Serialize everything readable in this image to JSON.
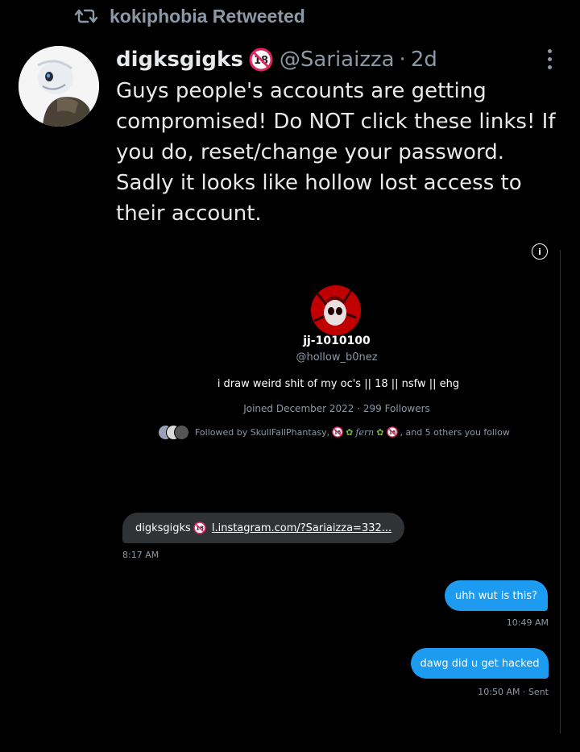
{
  "retweet": {
    "label": "kokiphobia Retweeted",
    "icon": "retweet-icon"
  },
  "tweet": {
    "author_name": "digksgigks",
    "author_handle": "@Sariaizza",
    "separator": "·",
    "time": "2d",
    "badge_text": "18",
    "text": "Guys people's accounts are getting compromised! Do NOT click these links! If you do, reset/change your password. Sadly it looks like hollow lost access to their account."
  },
  "media": {
    "info_glyph": "i",
    "profile": {
      "name": "jj-1010100",
      "handle": "@hollow_b0nez",
      "bio": "i draw weird shit of my oc's || 18 || nsfw ||   ehg",
      "joined": "Joined December 2022 · 299 Followers",
      "followed_by_prefix": "Followed by SkullFallPhantasy,",
      "followed_by_name2": "fern",
      "followed_by_suffix": ", and 5 others you follow",
      "mini_badge_text": "18"
    },
    "messages": [
      {
        "sender": "digksgigks",
        "badge": "18",
        "link": "l.instagram.com/?Sariaizza=332...",
        "time": "8:17 AM"
      },
      {
        "text": "uhh wut is this?",
        "time": "10:49 AM"
      },
      {
        "text": "dawg did u get hacked",
        "time": "10:50 AM · Sent"
      }
    ]
  },
  "colors": {
    "accent": "#1d9bf0",
    "muted": "#8b98a5",
    "background": "#000000",
    "badge_red": "#e0245e"
  }
}
